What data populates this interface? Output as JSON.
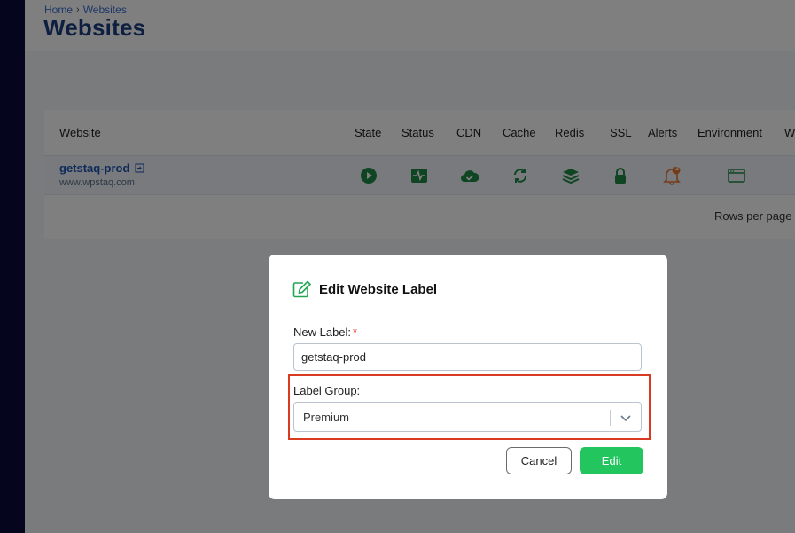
{
  "breadcrumb": {
    "home": "Home",
    "separator": "›",
    "current": "Websites"
  },
  "page_title": "Websites",
  "table": {
    "columns": [
      "Website",
      "State",
      "Status",
      "CDN",
      "Cache",
      "Redis",
      "SSL",
      "Alerts",
      "Environment",
      "W"
    ],
    "row": {
      "name": "getstaq-prod",
      "url": "www.wpstaq.com",
      "alert_count": "2",
      "icons": [
        "play-icon",
        "activity-icon",
        "cloud-check-icon",
        "refresh-icon",
        "layers-icon",
        "lock-icon",
        "bell-icon",
        "browser-window-icon"
      ]
    },
    "rows_per_page_label": "Rows per page"
  },
  "modal": {
    "title": "Edit Website Label",
    "new_label_text": "New Label:",
    "required_mark": "*",
    "new_label_value": "getstaq-prod",
    "label_group_text": "Label Group:",
    "label_group_value": "Premium",
    "cancel_label": "Cancel",
    "edit_label": "Edit"
  },
  "colors": {
    "sidebar": "#0b0a3a",
    "brand_blue": "#1b3d82",
    "icon_green": "#1e8a45",
    "alert_orange": "#e8772e",
    "primary_button": "#22c55e",
    "highlight_red": "#d83a22"
  }
}
